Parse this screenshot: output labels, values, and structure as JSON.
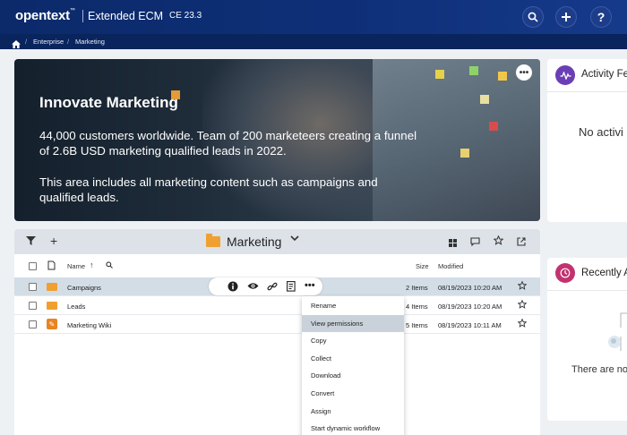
{
  "header": {
    "logo": "opentext",
    "logo_tm": "™",
    "product": "Extended ECM",
    "version": "CE 23.3",
    "icons": [
      "search-icon",
      "plus-icon",
      "help-icon"
    ]
  },
  "breadcrumb": {
    "home_icon": "home-icon",
    "items": [
      "Enterprise",
      "Marketing"
    ],
    "separator": "/"
  },
  "hero": {
    "title": "Innovate Marketing",
    "paragraph1": "44,000 customers worldwide. Team of 200 marketeers creating a funnel of 2.6B USD marketing qualified leads in 2022.",
    "paragraph2": "This area includes all marketing content such as campaigns and qualified leads.",
    "more_icon": "more-icon"
  },
  "browse": {
    "folder_title": "Marketing",
    "toolbar_icons": [
      "filter-icon",
      "add-icon",
      "grid-icon",
      "comment-icon",
      "favorite-icon",
      "open-external-icon"
    ],
    "columns": {
      "name": "Name",
      "size": "Size",
      "modified": "Modified"
    },
    "rows": [
      {
        "name": "Campaigns",
        "type": "folder",
        "size": "2 Items",
        "modified": "08/19/2023 10:20 AM",
        "selected": true
      },
      {
        "name": "Leads",
        "type": "folder",
        "size": "4 Items",
        "modified": "08/19/2023 10:20 AM",
        "selected": false
      },
      {
        "name": "Marketing Wiki",
        "type": "wiki",
        "size": "5 Items",
        "modified": "08/19/2023 10:11 AM",
        "selected": false
      }
    ],
    "inline_actions": [
      "info-icon",
      "view-icon",
      "link-icon",
      "properties-icon",
      "more-icon"
    ]
  },
  "context_menu": {
    "items": [
      "Rename",
      "View permissions",
      "Copy",
      "Collect",
      "Download",
      "Convert",
      "Assign",
      "Start dynamic workflow"
    ],
    "highlighted": "View permissions"
  },
  "widgets": {
    "activity": {
      "title": "Activity Fe",
      "empty": "No activi",
      "icon": "activity-icon",
      "color": "#6a3fb5"
    },
    "recent": {
      "title": "Recently A",
      "empty": "There are no",
      "icon": "clock-icon",
      "color": "#c2326e"
    }
  },
  "colors": {
    "header": "#0e2f78",
    "breadcrumb": "#0a245d",
    "folder": "#f0a030",
    "selected_row": "#d3dde6"
  }
}
